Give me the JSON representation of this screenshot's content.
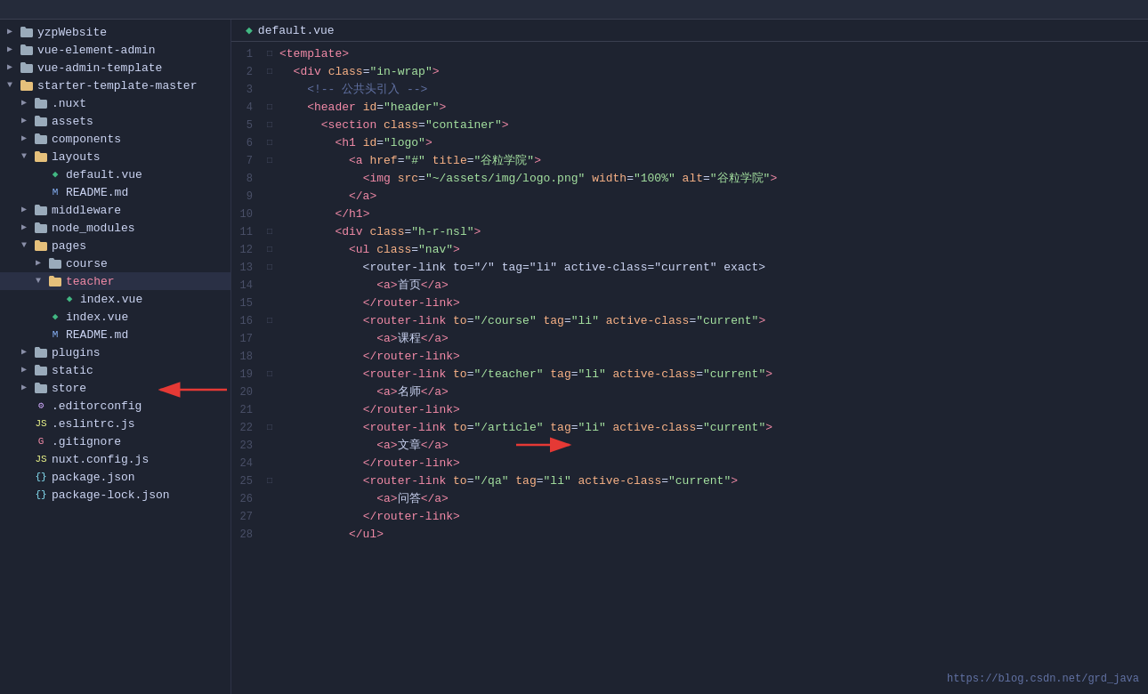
{
  "tab": {
    "filename": "default.vue",
    "vue_icon": "◆"
  },
  "sidebar": {
    "items": [
      {
        "id": "yzpWebsite",
        "label": "yzpWebsite",
        "type": "folder",
        "indent": 1,
        "expanded": false,
        "chevron": "▶"
      },
      {
        "id": "vue-element-admin",
        "label": "vue-element-admin",
        "type": "folder",
        "indent": 1,
        "expanded": false,
        "chevron": "▶"
      },
      {
        "id": "vue-admin-template",
        "label": "vue-admin-template",
        "type": "folder",
        "indent": 1,
        "expanded": false,
        "chevron": "▶"
      },
      {
        "id": "starter-template-master",
        "label": "starter-template-master",
        "type": "folder",
        "indent": 1,
        "expanded": true,
        "chevron": "▼"
      },
      {
        "id": "nuxt",
        "label": ".nuxt",
        "type": "folder",
        "indent": 2,
        "expanded": false,
        "chevron": "▶"
      },
      {
        "id": "assets",
        "label": "assets",
        "type": "folder",
        "indent": 2,
        "expanded": false,
        "chevron": "▶"
      },
      {
        "id": "components",
        "label": "components",
        "type": "folder",
        "indent": 2,
        "expanded": false,
        "chevron": "▶"
      },
      {
        "id": "layouts",
        "label": "layouts",
        "type": "folder",
        "indent": 2,
        "expanded": true,
        "chevron": "▼"
      },
      {
        "id": "default.vue",
        "label": "default.vue",
        "type": "vue",
        "indent": 3
      },
      {
        "id": "README.md",
        "label": "README.md",
        "type": "md",
        "indent": 3
      },
      {
        "id": "middleware",
        "label": "middleware",
        "type": "folder",
        "indent": 2,
        "expanded": false,
        "chevron": "▶"
      },
      {
        "id": "node_modules",
        "label": "node_modules",
        "type": "folder",
        "indent": 2,
        "expanded": false,
        "chevron": "▶"
      },
      {
        "id": "pages",
        "label": "pages",
        "type": "folder",
        "indent": 2,
        "expanded": true,
        "chevron": "▼"
      },
      {
        "id": "course",
        "label": "course",
        "type": "folder",
        "indent": 3,
        "expanded": false,
        "chevron": "▶"
      },
      {
        "id": "teacher",
        "label": "teacher",
        "type": "folder",
        "indent": 3,
        "expanded": true,
        "chevron": "▼"
      },
      {
        "id": "index.vue-teacher",
        "label": "index.vue",
        "type": "vue",
        "indent": 4
      },
      {
        "id": "index.vue-pages",
        "label": "index.vue",
        "type": "vue",
        "indent": 3
      },
      {
        "id": "README.md-pages",
        "label": "README.md",
        "type": "md",
        "indent": 3
      },
      {
        "id": "plugins",
        "label": "plugins",
        "type": "folder",
        "indent": 2,
        "expanded": false,
        "chevron": "▶"
      },
      {
        "id": "static",
        "label": "static",
        "type": "folder",
        "indent": 2,
        "expanded": false,
        "chevron": "▶"
      },
      {
        "id": "store",
        "label": "store",
        "type": "folder",
        "indent": 2,
        "expanded": false,
        "chevron": "▶"
      },
      {
        "id": ".editorconfig",
        "label": ".editorconfig",
        "type": "config",
        "indent": 2
      },
      {
        "id": ".eslintrc.js",
        "label": ".eslintrc.js",
        "type": "js",
        "indent": 2
      },
      {
        "id": ".gitignore",
        "label": ".gitignore",
        "type": "git",
        "indent": 2
      },
      {
        "id": "nuxt.config.js",
        "label": "nuxt.config.js",
        "type": "js",
        "indent": 2
      },
      {
        "id": "package.json",
        "label": "package.json",
        "type": "json",
        "indent": 2
      },
      {
        "id": "package-lock.json",
        "label": "package-lock.json",
        "type": "json",
        "indent": 2
      }
    ]
  },
  "code_lines": [
    {
      "num": 1,
      "fold": "□",
      "content": "<template>"
    },
    {
      "num": 2,
      "fold": "□",
      "content": "  <div class=\"in-wrap\">"
    },
    {
      "num": 3,
      "fold": " ",
      "content": "    <!-- 公共头引入 -->"
    },
    {
      "num": 4,
      "fold": "□",
      "content": "    <header id=\"header\">"
    },
    {
      "num": 5,
      "fold": "□",
      "content": "      <section class=\"container\">"
    },
    {
      "num": 6,
      "fold": "□",
      "content": "        <h1 id=\"logo\">"
    },
    {
      "num": 7,
      "fold": "□",
      "content": "          <a href=\"#\" title=\"谷粒学院\">"
    },
    {
      "num": 8,
      "fold": " ",
      "content": "            <img src=\"~/assets/img/logo.png\" width=\"100%\" alt=\"谷粒学院\">"
    },
    {
      "num": 9,
      "fold": " ",
      "content": "          </a>"
    },
    {
      "num": 10,
      "fold": " ",
      "content": "        </h1>"
    },
    {
      "num": 11,
      "fold": "□",
      "content": "        <div class=\"h-r-nsl\">"
    },
    {
      "num": 12,
      "fold": "□",
      "content": "          <ul class=\"nav\">"
    },
    {
      "num": 13,
      "fold": "□",
      "content": "            <router-link to=\"/\" tag=\"li\" active-class=\"current\" exact>"
    },
    {
      "num": 14,
      "fold": " ",
      "content": "              <a>首页</a>"
    },
    {
      "num": 15,
      "fold": " ",
      "content": "            </router-link>"
    },
    {
      "num": 16,
      "fold": "□",
      "content": "            <router-link to=\"/course\" tag=\"li\" active-class=\"current\">"
    },
    {
      "num": 17,
      "fold": " ",
      "content": "              <a>课程</a>"
    },
    {
      "num": 18,
      "fold": " ",
      "content": "            </router-link>"
    },
    {
      "num": 19,
      "fold": "□",
      "content": "            <router-link to=\"/teacher\" tag=\"li\" active-class=\"current\">"
    },
    {
      "num": 20,
      "fold": " ",
      "content": "              <a>名师</a>"
    },
    {
      "num": 21,
      "fold": " ",
      "content": "            </router-link>"
    },
    {
      "num": 22,
      "fold": "□",
      "content": "            <router-link to=\"/article\" tag=\"li\" active-class=\"current\">"
    },
    {
      "num": 23,
      "fold": " ",
      "content": "              <a>文章</a>"
    },
    {
      "num": 24,
      "fold": " ",
      "content": "            </router-link>"
    },
    {
      "num": 25,
      "fold": "□",
      "content": "            <router-link to=\"/qa\" tag=\"li\" active-class=\"current\">"
    },
    {
      "num": 26,
      "fold": " ",
      "content": "              <a>问答</a>"
    },
    {
      "num": 27,
      "fold": " ",
      "content": "            </router-link>"
    },
    {
      "num": 28,
      "fold": " ",
      "content": "          </ul>"
    }
  ],
  "watermark": {
    "text": "https://blog.csdn.net/grd_java"
  }
}
